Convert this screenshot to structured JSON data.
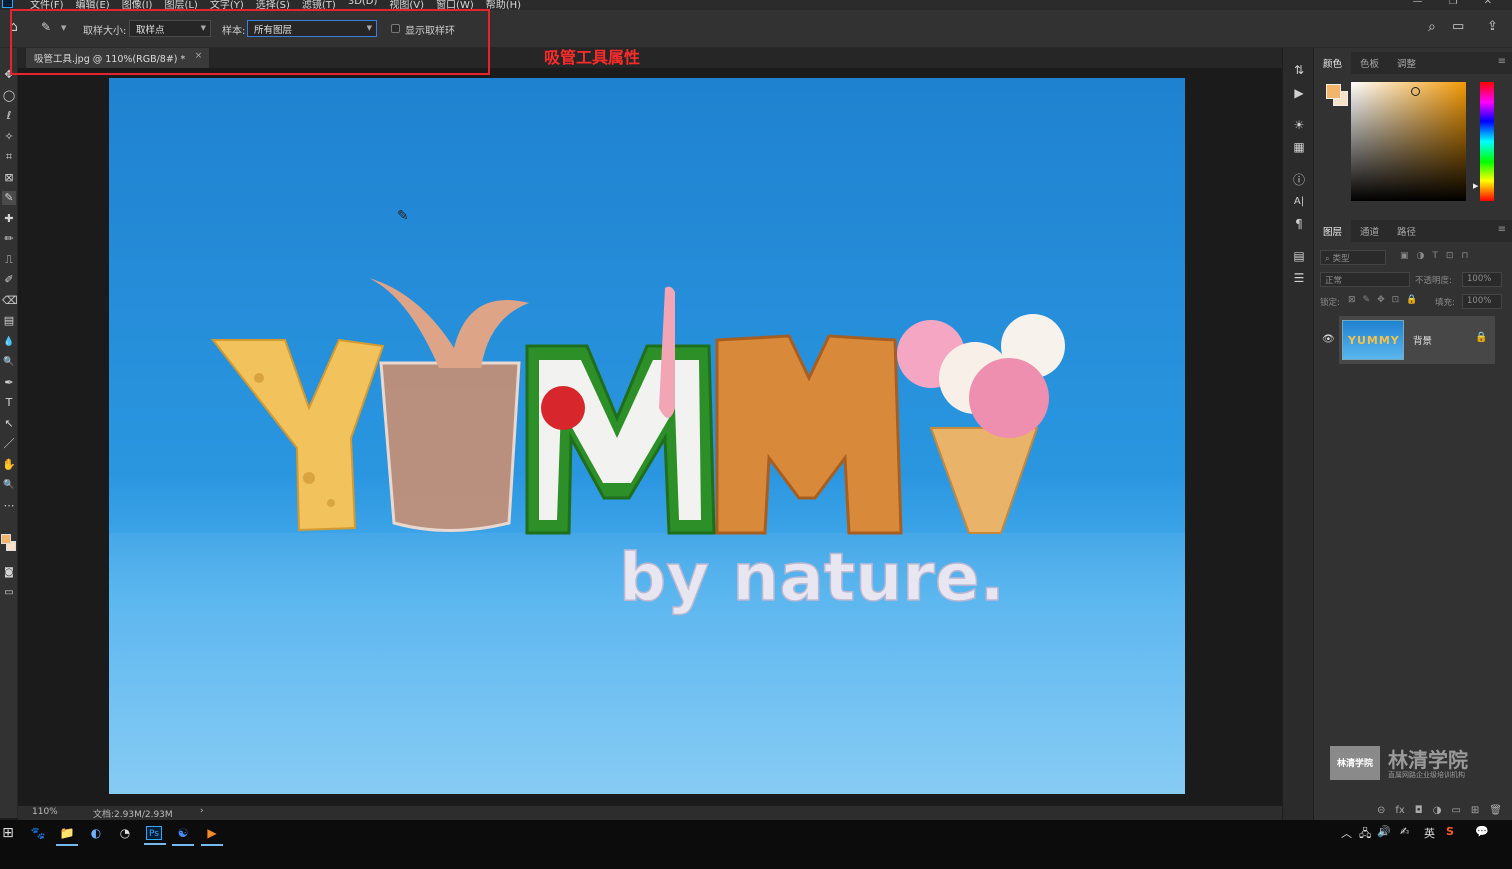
{
  "menubar": {
    "items": [
      "文件(F)",
      "编辑(E)",
      "图像(I)",
      "图层(L)",
      "文字(Y)",
      "选择(S)",
      "滤镜(T)",
      "3D(D)",
      "视图(V)",
      "窗口(W)",
      "帮助(H)"
    ],
    "window_controls": [
      "—",
      "❐",
      "✕"
    ]
  },
  "options": {
    "home_icon": "⌂",
    "tool_icon": "✎",
    "sample_size_label": "取样大小:",
    "sample_size_value": "取样点",
    "sample_label": "样本:",
    "sample_value": "所有图层",
    "show_ring_label": "显示取样环",
    "search_icon": "⌕",
    "workspace_icon": "▭",
    "share_icon": "⇪"
  },
  "annotation": "吸管工具属性",
  "document": {
    "tab_title": "吸管工具.jpg @ 110%(RGB/8#) *",
    "close": "×"
  },
  "status": {
    "zoom": "110%",
    "doc_size": "文档:2.93M/2.93M",
    "arrow": "›"
  },
  "tools": [
    "✥",
    "◯",
    "ℓ",
    "✧",
    "⌗",
    "⊠",
    "✎",
    "✚",
    "✏",
    "⎍",
    "✐",
    "⌫",
    "▤",
    "💧",
    "🔍",
    "✒",
    "T",
    "↖",
    "／",
    "✋",
    "🔍",
    "⋯"
  ],
  "minicol": [
    "⇅",
    "▶",
    "☀",
    "▦",
    "ⓘ",
    "A|",
    "¶",
    "▤",
    "☰"
  ],
  "color_panel": {
    "tabs": [
      "颜色",
      "色板",
      "调整"
    ],
    "active_tab": 0,
    "foreground": "#f3b56a",
    "background": "#f7e2c8"
  },
  "layers_panel": {
    "tabs": [
      "图层",
      "通道",
      "路径"
    ],
    "active_tab": 0,
    "filter_placeholder": "类型",
    "blend_mode": "正常",
    "opacity_label": "不透明度:",
    "opacity_value": "100%",
    "lock_label": "锁定:",
    "fill_label": "填充:",
    "fill_value": "100%",
    "layer_thumb_text": "YUMMY",
    "layer_name": "背景",
    "footer_icons": [
      "⊝",
      "fx",
      "◘",
      "◑",
      "▭",
      "⊞",
      "🗑"
    ]
  },
  "watermark": {
    "box_text": "林清学院",
    "title": "林清学院",
    "subtitle": "直属网路企业级培训机构"
  },
  "taskbar": {
    "icons": [
      "⊞",
      "🐾",
      "📁",
      "◐",
      "◔",
      "Ps",
      "☯",
      "▶"
    ],
    "tray": [
      "︿",
      "🖧",
      "🔊",
      "✍",
      "英",
      "S",
      "💬"
    ]
  }
}
